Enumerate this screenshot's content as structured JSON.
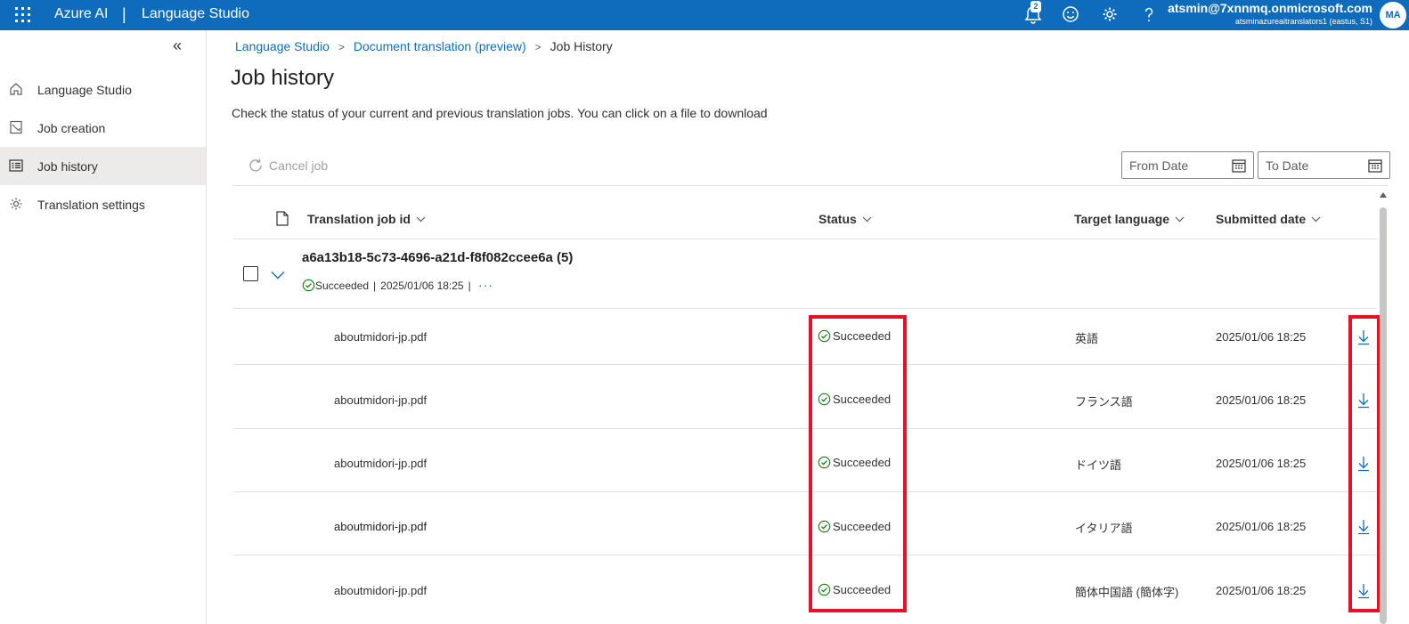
{
  "header": {
    "brand": "Azure AI",
    "separator": "|",
    "product": "Language Studio",
    "notification_count": "2",
    "account_email": "atsmin@7xnnmq.onmicrosoft.com",
    "account_resource": "atsminazureaitranslators1 (eastus, S1)",
    "avatar_initials": "MA",
    "icons": [
      "waffle-icon",
      "notification-icon",
      "feedback-smiley-icon",
      "settings-gear-icon",
      "help-icon"
    ]
  },
  "sidebar": {
    "collapse_glyph": "«",
    "items": [
      {
        "label": "Language Studio",
        "icon": "home-icon",
        "active": false
      },
      {
        "label": "Job creation",
        "icon": "document-edit-icon",
        "active": false
      },
      {
        "label": "Job history",
        "icon": "list-icon",
        "active": true
      },
      {
        "label": "Translation settings",
        "icon": "gear-icon",
        "active": false
      }
    ]
  },
  "breadcrumb": {
    "items": [
      "Language Studio",
      "Document translation (preview)",
      "Job History"
    ]
  },
  "page": {
    "title": "Job history",
    "description": "Check the status of your current and previous translation jobs. You can click on a file to download"
  },
  "toolbar": {
    "cancel_label": "Cancel job",
    "from_date_placeholder": "From Date",
    "to_date_placeholder": "To Date"
  },
  "table": {
    "columns": [
      "Translation job id",
      "Status",
      "Target language",
      "Submitted date"
    ],
    "group": {
      "job_id": "a6a13b18-5c73-4696-a21d-f8f082ccee6a (5)",
      "status": "Succeeded",
      "sep1": "|",
      "submitted": "2025/01/06 18:25",
      "sep2": "|",
      "more": "···"
    },
    "rows": [
      {
        "file": "aboutmidori-jp.pdf",
        "status": "Succeeded",
        "language": "英語",
        "date": "2025/01/06 18:25"
      },
      {
        "file": "aboutmidori-jp.pdf",
        "status": "Succeeded",
        "language": "フランス語",
        "date": "2025/01/06 18:25"
      },
      {
        "file": "aboutmidori-jp.pdf",
        "status": "Succeeded",
        "language": "ドイツ語",
        "date": "2025/01/06 18:25"
      },
      {
        "file": "aboutmidori-jp.pdf",
        "status": "Succeeded",
        "language": "イタリア語",
        "date": "2025/01/06 18:25"
      },
      {
        "file": "aboutmidori-jp.pdf",
        "status": "Succeeded",
        "language": "簡体中国語 (簡体字)",
        "date": "2025/01/06 18:25"
      }
    ]
  },
  "colors": {
    "topbar": "#0f6cbd",
    "link": "#0f6cbd",
    "success": "#107c10",
    "highlight": "#e81123",
    "active_nav": "#edebe9"
  }
}
